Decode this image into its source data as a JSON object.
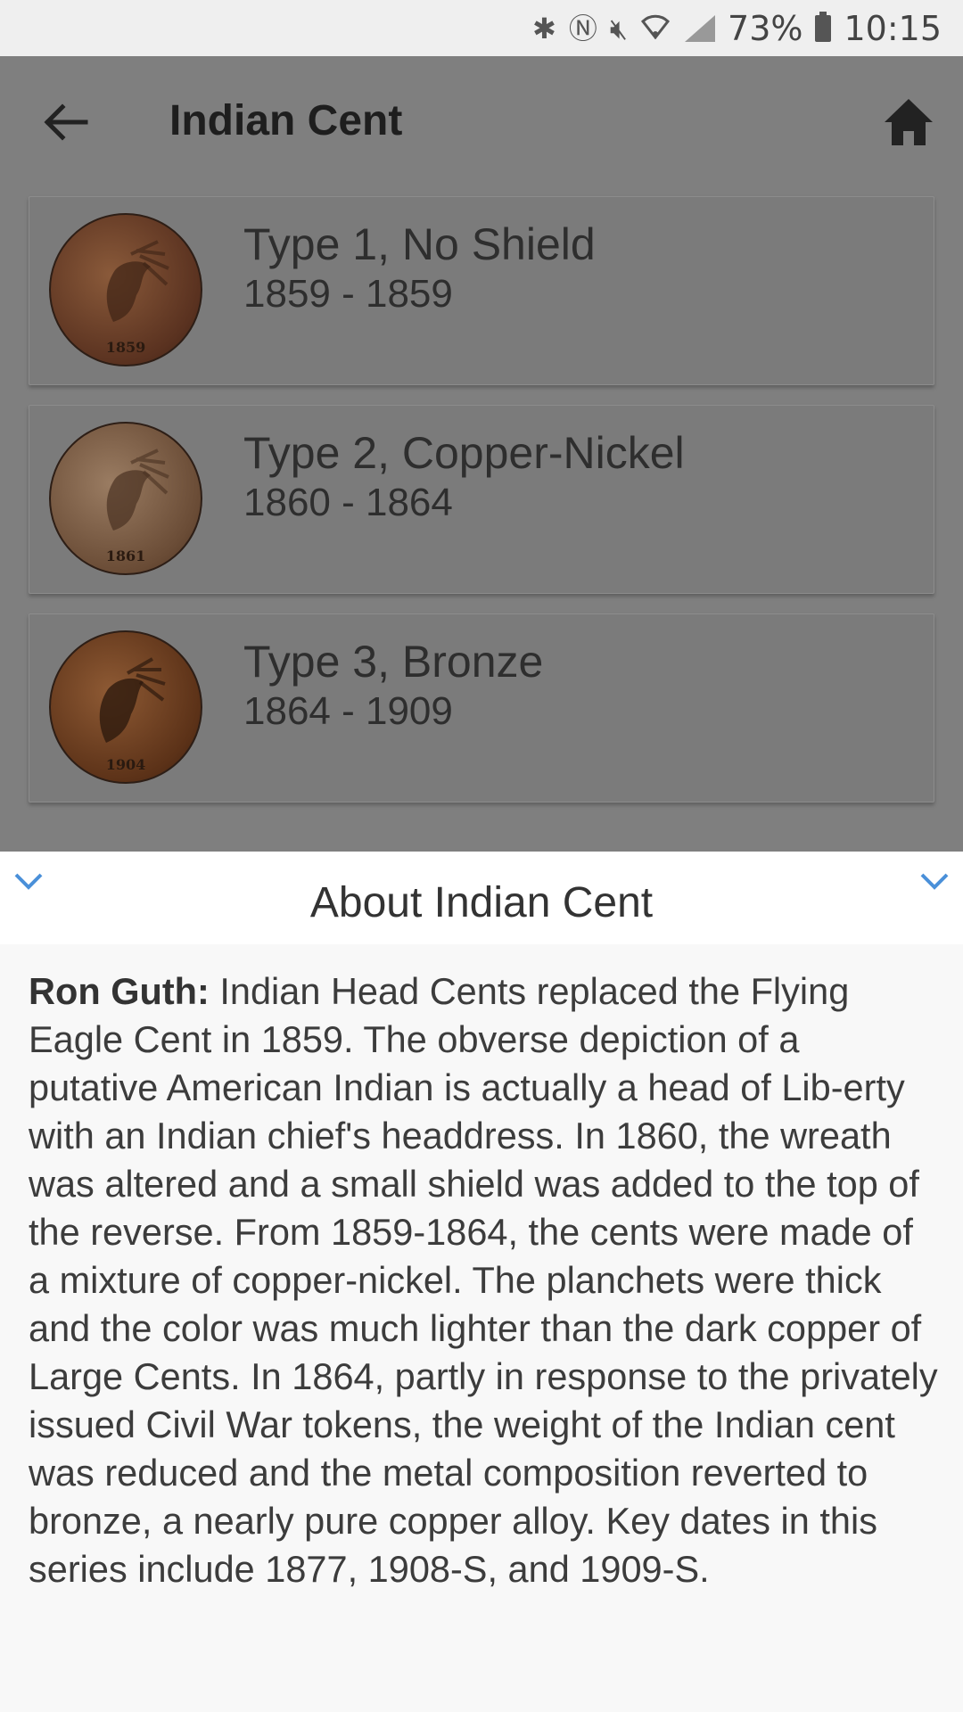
{
  "status_bar": {
    "battery": "73%",
    "time": "10:15",
    "icons": [
      "bluetooth-icon",
      "nfc-icon",
      "mute-icon",
      "wifi-icon",
      "signal-icon",
      "battery-icon"
    ]
  },
  "toolbar": {
    "title": "Indian Cent",
    "back_icon": "arrow-left-icon",
    "home_icon": "home-icon"
  },
  "types": [
    {
      "title": "Type 1, No Shield",
      "years": "1859 - 1859",
      "coin_year": "1859",
      "coin_color": "#6b3f26"
    },
    {
      "title": "Type 2, Copper-Nickel",
      "years": "1860 - 1864",
      "coin_year": "1861",
      "coin_color": "#7a5a44"
    },
    {
      "title": "Type 3, Bronze",
      "years": "1864 - 1909",
      "coin_year": "1904",
      "coin_color": "#6a3a1e"
    }
  ],
  "about": {
    "title": "About Indian Cent",
    "author": "Ron Guth:",
    "text": " Indian Head Cents replaced the Flying Eagle Cent in 1859.  The obverse depiction of a putative American Indian is actually a head of Lib-erty with an Indian chief's headdress.  In 1860, the wreath was altered and a small shield was added to the top of the reverse.  From 1859-1864, the cents were made of a mixture of copper-nickel.  The planchets were thick and the color was much lighter than the dark copper of Large Cents.  In 1864, partly in response to the privately issued Civil War tokens, the weight of the Indian cent was reduced and the metal composition reverted to bronze, a nearly pure copper alloy.  Key dates in this series include 1877, 1908-S, and 1909-S."
  },
  "colors": {
    "accent": "#4a90d9",
    "scrim": "#7f7f7f"
  }
}
